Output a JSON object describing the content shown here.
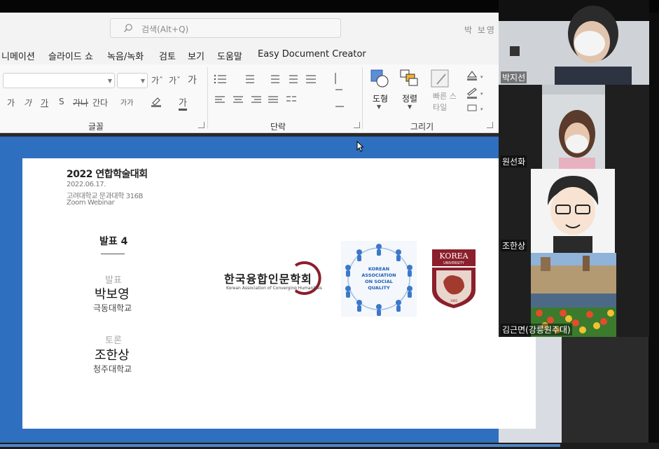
{
  "window": {
    "search_placeholder": "검색(Alt+Q)",
    "user_name": "박 보영"
  },
  "menu": {
    "items": [
      "니메이션",
      "슬라이드 쇼",
      "녹음/녹화",
      "검토",
      "보기",
      "도움말",
      "Easy Document Creator"
    ]
  },
  "ribbon": {
    "groups": {
      "font": "글꼴",
      "paragraph": "단락",
      "drawing": "그리기"
    },
    "font_tools": {
      "grow": "가ˆ",
      "shrink": "가ˇ",
      "clear": "가",
      "row2": [
        "가",
        "가",
        "가",
        "S",
        "가나",
        "간다",
        "가가"
      ],
      "highlight": "가"
    },
    "drawing_tools": {
      "shape": "도형",
      "arrange": "정렬",
      "quick_style": "빠른 스타일"
    }
  },
  "slide": {
    "title": "2022 연합학술대회",
    "date": "2022.06.17.",
    "venue": "고려대학교 문과대학 316B",
    "webinar": "Zoom Webinar",
    "talk": "발표 4",
    "presenter_role": "발표",
    "presenter_name": "박보영",
    "presenter_affiliation": "극동대학교",
    "discussant_role": "토론",
    "discussant_name": "조한상",
    "discussant_affiliation": "청주대학교",
    "logo1_name": "한국융합인문학회",
    "logo1_english": "Korean Association of Converging Humanities",
    "logo2_text": [
      "KOREAN",
      "ASSOCIATION",
      "ON SOCIAL",
      "QUALITY"
    ],
    "logo3_text": [
      "KOREA",
      "UNIVERSITY",
      "1905"
    ]
  },
  "participants": [
    {
      "name": "박지선"
    },
    {
      "name": "원선화"
    },
    {
      "name": "조한상"
    },
    {
      "name": "김근면(강릉원주대)"
    }
  ],
  "colors": {
    "slide_border": "#2f6fc0",
    "ku_crimson": "#8b1f2b",
    "ksq_blue": "#1f5fb4"
  }
}
